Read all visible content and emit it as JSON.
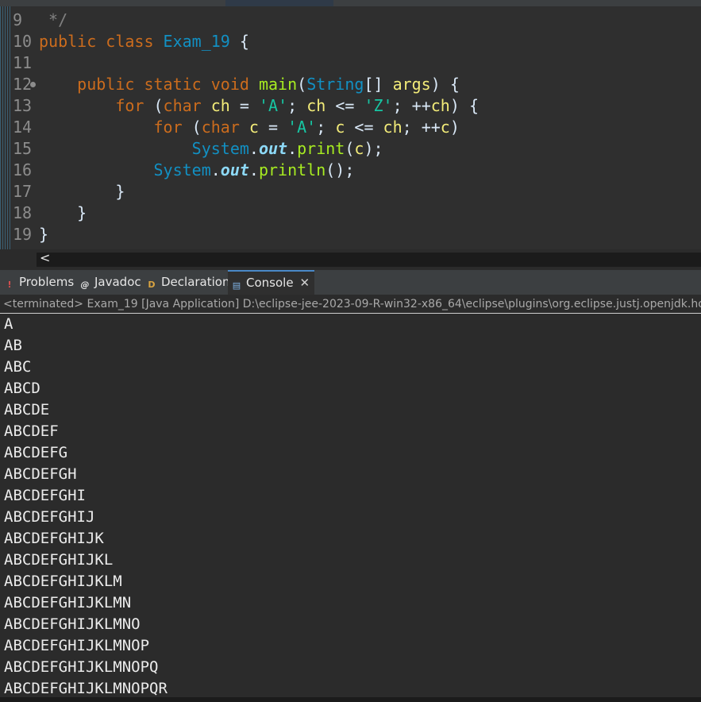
{
  "editor": {
    "lines": [
      {
        "num": "9",
        "tokens": [
          {
            "t": " */",
            "c": "cm"
          }
        ]
      },
      {
        "num": "10",
        "tokens": [
          {
            "t": "public ",
            "c": "kw"
          },
          {
            "t": "class ",
            "c": "kw"
          },
          {
            "t": "Exam_19",
            "c": "ty"
          },
          {
            "t": " {",
            "c": "plain"
          }
        ]
      },
      {
        "num": "11",
        "tokens": []
      },
      {
        "num": "12",
        "fold": true,
        "tokens": [
          {
            "t": "    public ",
            "c": "kw"
          },
          {
            "t": "static ",
            "c": "kw"
          },
          {
            "t": "void ",
            "c": "kw"
          },
          {
            "t": "main",
            "c": "fn"
          },
          {
            "t": "(",
            "c": "plain"
          },
          {
            "t": "String",
            "c": "ty"
          },
          {
            "t": "[] ",
            "c": "plain"
          },
          {
            "t": "args",
            "c": "var"
          },
          {
            "t": ") {",
            "c": "plain"
          }
        ]
      },
      {
        "num": "13",
        "tokens": [
          {
            "t": "        for ",
            "c": "kw"
          },
          {
            "t": "(",
            "c": "plain"
          },
          {
            "t": "char ",
            "c": "kw"
          },
          {
            "t": "ch",
            "c": "var"
          },
          {
            "t": " = ",
            "c": "plain"
          },
          {
            "t": "'A'",
            "c": "str"
          },
          {
            "t": "; ",
            "c": "plain"
          },
          {
            "t": "ch",
            "c": "var"
          },
          {
            "t": " <= ",
            "c": "plain"
          },
          {
            "t": "'Z'",
            "c": "str"
          },
          {
            "t": "; ++",
            "c": "plain"
          },
          {
            "t": "ch",
            "c": "var"
          },
          {
            "t": ") {",
            "c": "plain"
          }
        ]
      },
      {
        "num": "14",
        "tokens": [
          {
            "t": "            for ",
            "c": "kw"
          },
          {
            "t": "(",
            "c": "plain"
          },
          {
            "t": "char ",
            "c": "kw"
          },
          {
            "t": "c",
            "c": "var"
          },
          {
            "t": " = ",
            "c": "plain"
          },
          {
            "t": "'A'",
            "c": "str"
          },
          {
            "t": "; ",
            "c": "plain"
          },
          {
            "t": "c",
            "c": "var"
          },
          {
            "t": " <= ",
            "c": "plain"
          },
          {
            "t": "ch",
            "c": "var"
          },
          {
            "t": "; ++",
            "c": "plain"
          },
          {
            "t": "c",
            "c": "var"
          },
          {
            "t": ")",
            "c": "plain"
          }
        ]
      },
      {
        "num": "15",
        "tokens": [
          {
            "t": "                System",
            "c": "ty"
          },
          {
            "t": ".",
            "c": "plain"
          },
          {
            "t": "out",
            "c": "field"
          },
          {
            "t": ".",
            "c": "plain"
          },
          {
            "t": "print",
            "c": "fn"
          },
          {
            "t": "(",
            "c": "plain"
          },
          {
            "t": "c",
            "c": "var"
          },
          {
            "t": ");",
            "c": "plain"
          }
        ]
      },
      {
        "num": "16",
        "tokens": [
          {
            "t": "            System",
            "c": "ty"
          },
          {
            "t": ".",
            "c": "plain"
          },
          {
            "t": "out",
            "c": "field"
          },
          {
            "t": ".",
            "c": "plain"
          },
          {
            "t": "println",
            "c": "fn"
          },
          {
            "t": "();",
            "c": "plain"
          }
        ]
      },
      {
        "num": "17",
        "tokens": [
          {
            "t": "        }",
            "c": "plain"
          }
        ]
      },
      {
        "num": "18",
        "tokens": [
          {
            "t": "    }",
            "c": "plain"
          }
        ]
      },
      {
        "num": "19",
        "tokens": [
          {
            "t": "}",
            "c": "plain"
          }
        ]
      }
    ]
  },
  "scrollbar": {
    "left_arrow": "<"
  },
  "views": {
    "tabs": [
      {
        "label": "Problems",
        "icon": "problems-icon",
        "glyph": "!",
        "color": "#d94f4f"
      },
      {
        "label": "Javadoc",
        "icon": "javadoc-icon",
        "glyph": "@",
        "color": "#e6e6e6"
      },
      {
        "label": "Declaration",
        "icon": "declaration-icon",
        "glyph": "D",
        "color": "#d9a441"
      },
      {
        "label": "Console",
        "icon": "console-icon",
        "glyph": "▤",
        "color": "#7fb3e6",
        "active": true
      }
    ],
    "close_glyph": "✕"
  },
  "console": {
    "header": "<terminated> Exam_19 [Java Application] D:\\eclipse-jee-2023-09-R-win32-x86_64\\eclipse\\plugins\\org.eclipse.justj.openjdk.hots",
    "output": [
      "A",
      "AB",
      "ABC",
      "ABCD",
      "ABCDE",
      "ABCDEF",
      "ABCDEFG",
      "ABCDEFGH",
      "ABCDEFGHI",
      "ABCDEFGHIJ",
      "ABCDEFGHIJK",
      "ABCDEFGHIJKL",
      "ABCDEFGHIJKLM",
      "ABCDEFGHIJKLMN",
      "ABCDEFGHIJKLMNO",
      "ABCDEFGHIJKLMNOP",
      "ABCDEFGHIJKLMNOPQ",
      "ABCDEFGHIJKLMNOPQR"
    ]
  },
  "colors": {
    "keyword": "#cc6c1d",
    "type": "#1290c3",
    "method": "#a7ec21",
    "variable": "#f3ec79",
    "string": "#17c6a3",
    "background": "#2f2f2f"
  }
}
